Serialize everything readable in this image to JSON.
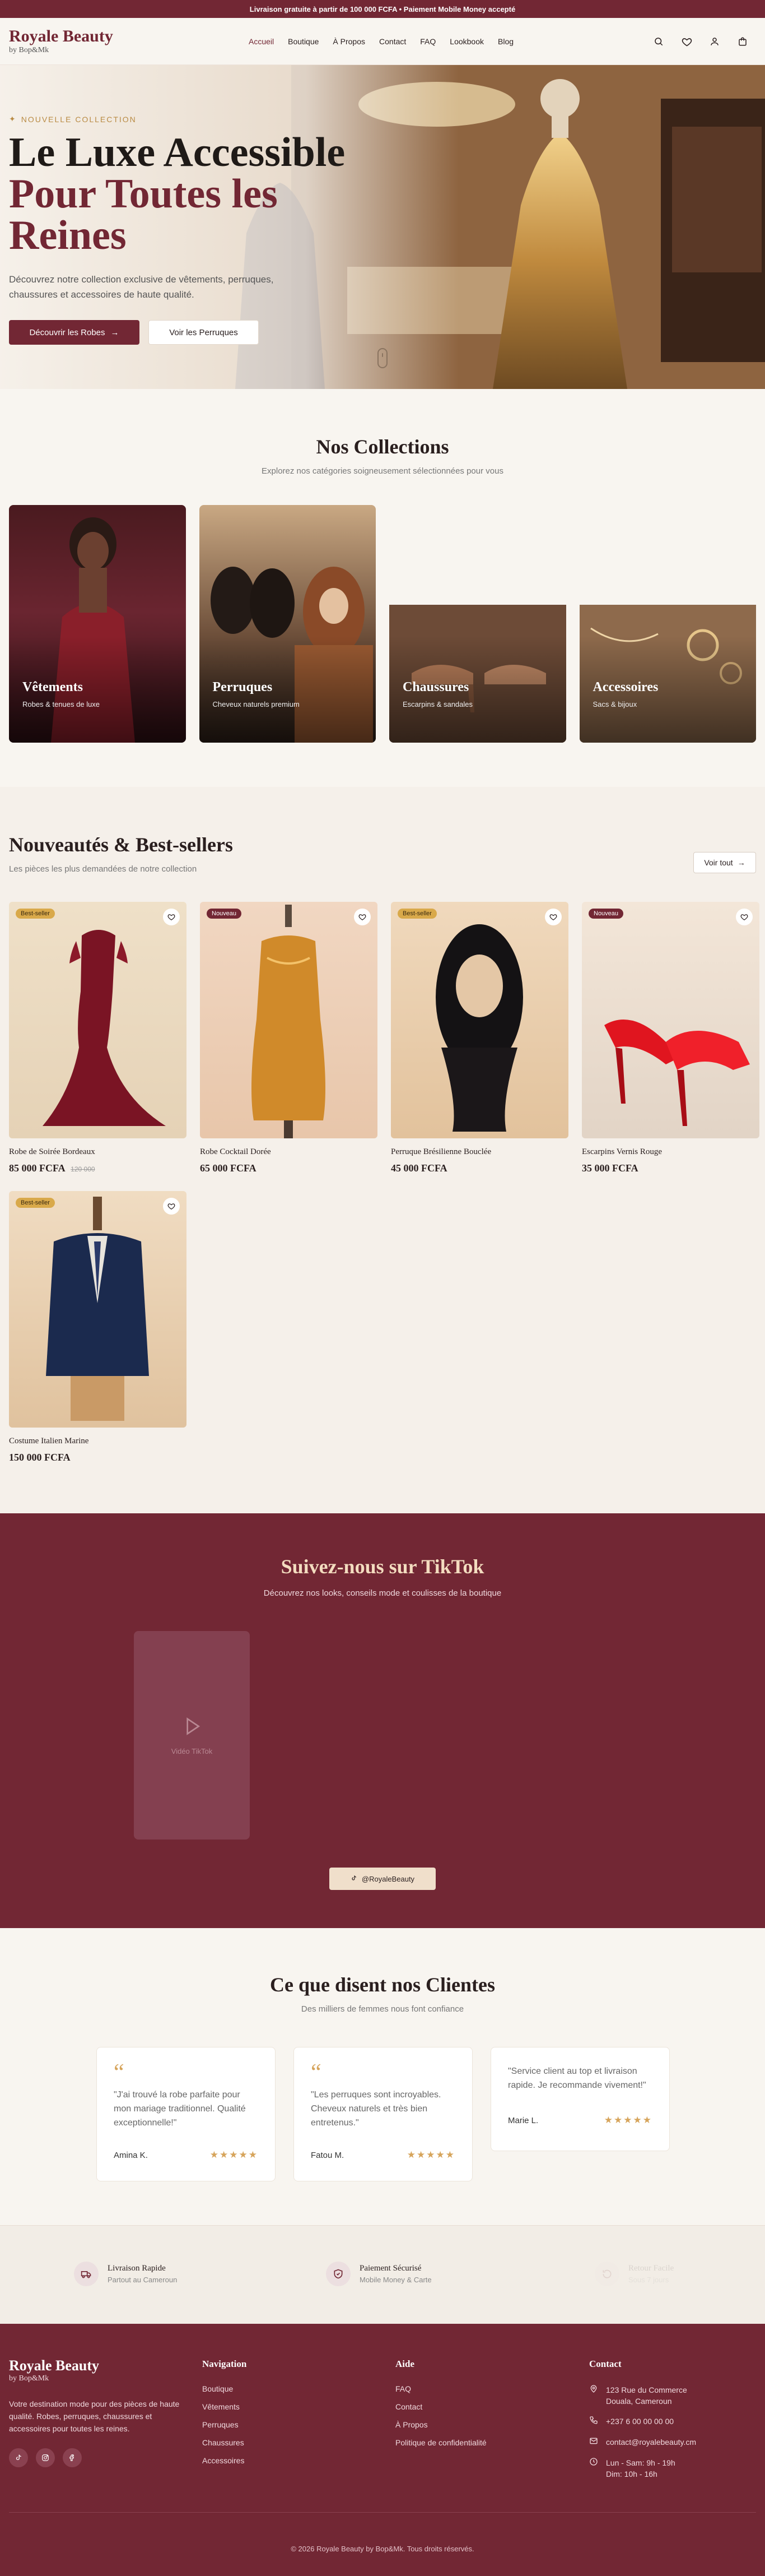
{
  "topbar": {
    "text": "Livraison gratuite à partir de 100 000 FCFA • Paiement Mobile Money accepté"
  },
  "header": {
    "brand": "Royale Beauty",
    "brand_sub": "by Bop&Mk",
    "nav": [
      "Accueil",
      "Boutique",
      "À Propos",
      "Contact",
      "FAQ",
      "Lookbook",
      "Blog"
    ],
    "icons": [
      "search-icon",
      "heart-icon",
      "user-icon",
      "bag-icon"
    ]
  },
  "hero": {
    "tag": "NOUVELLE COLLECTION",
    "title_line1": "Le Luxe Accessible",
    "title_line2": "Pour Toutes les",
    "title_line3": "Reines",
    "description": "Découvrez notre collection exclusive de vêtements, perruques, chaussures et accessoires de haute qualité.",
    "btn_primary": "Découvrir les Robes",
    "btn_secondary": "Voir les Perruques"
  },
  "collections": {
    "title": "Nos Collections",
    "subtitle": "Explorez nos catégories soigneusement sélectionnées pour vous",
    "items": [
      {
        "name": "Vêtements",
        "desc": "Robes & tenues de luxe"
      },
      {
        "name": "Perruques",
        "desc": "Cheveux naturels premium"
      },
      {
        "name": "Chaussures",
        "desc": "Escarpins & sandales"
      },
      {
        "name": "Accessoires",
        "desc": "Sacs & bijoux"
      }
    ]
  },
  "products": {
    "title": "Nouveautés & Best-sellers",
    "subtitle": "Les pièces les plus demandées de notre collection",
    "see_all": "Voir tout",
    "items": [
      {
        "badge": "Best-seller",
        "name": "Robe de Soirée Bordeaux",
        "price": "85 000 FCFA",
        "old_price": "120 000"
      },
      {
        "badge": "Nouveau",
        "name": "Robe Cocktail Dorée",
        "price": "65 000 FCFA",
        "old_price": ""
      },
      {
        "badge": "Best-seller",
        "name": "Perruque Brésilienne Bouclée",
        "price": "45 000 FCFA",
        "old_price": ""
      },
      {
        "badge": "Nouveau",
        "name": "Escarpins Vernis Rouge",
        "price": "35 000 FCFA",
        "old_price": ""
      },
      {
        "badge": "Best-seller",
        "name": "Costume Italien Marine",
        "price": "150 000 FCFA",
        "old_price": ""
      }
    ]
  },
  "tiktok": {
    "title": "Suivez-nous sur TikTok",
    "subtitle": "Découvrez nos looks, conseils mode et coulisses de la boutique",
    "video_label": "Vidéo TikTok",
    "button": "@RoyaleBeauty"
  },
  "testimonials": {
    "title": "Ce que disent nos Clientes",
    "subtitle": "Des milliers de femmes nous font confiance",
    "items": [
      {
        "quote": "“",
        "text": "\"J'ai trouvé la robe parfaite pour mon mariage traditionnel. Qualité exceptionnelle!\"",
        "name": "Amina K.",
        "stars": "★★★★★"
      },
      {
        "quote": "“",
        "text": "\"Les perruques sont incroyables. Cheveux naturels et très bien entretenus.\"",
        "name": "Fatou M.",
        "stars": "★★★★★"
      },
      {
        "quote": "",
        "text": "\"Service client au top et livraison rapide. Je recommande vivement!\"",
        "name": "Marie L.",
        "stars": "★★★★★"
      }
    ]
  },
  "features": [
    {
      "title": "Livraison Rapide",
      "subtitle": "Partout au Cameroun",
      "icon": "truck-icon"
    },
    {
      "title": "Paiement Sécurisé",
      "subtitle": "Mobile Money & Carte",
      "icon": "shield-icon"
    },
    {
      "title": "Retour Facile",
      "subtitle": "Sous 7 jours",
      "icon": "return-icon"
    }
  ],
  "footer": {
    "brand": "Royale Beauty",
    "brand_sub": "by Bop&Mk",
    "about": "Votre destination mode pour des pièces de haute qualité. Robes, perruques, chaussures et accessoires pour toutes les reines.",
    "nav_title": "Navigation",
    "nav_links": [
      "Boutique",
      "Vêtements",
      "Perruques",
      "Chaussures",
      "Accessoires"
    ],
    "help_title": "Aide",
    "help_links": [
      "FAQ",
      "Contact",
      "À Propos",
      "Politique de confidentialité"
    ],
    "contact_title": "Contact",
    "address_line1": "123 Rue du Commerce",
    "address_line2": "Douala, Cameroun",
    "phone": "+237 6 00 00 00 00",
    "email": "contact@royalebeauty.cm",
    "hours_line1": "Lun - Sam: 9h - 19h",
    "hours_line2": "Dim: 10h - 16h",
    "copyright": "© 2026 Royale Beauty by Bop&Mk. Tous droits réservés."
  }
}
